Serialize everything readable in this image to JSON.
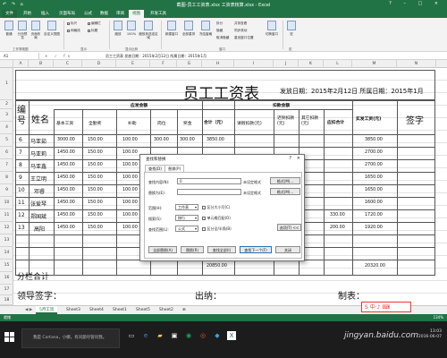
{
  "window": {
    "title": "截图-员工工资表.xlsx 工资表核算.xlsx - Excel",
    "quick_access": "↶ ↷ ⌂",
    "controls": "? – □ ×"
  },
  "ribbon_tabs": [
    "文件",
    "开始",
    "插入",
    "页面布局",
    "公式",
    "数据",
    "审阅",
    "视图",
    "开发工具"
  ],
  "ribbon": {
    "normal": "普通",
    "page_break": "分页预览",
    "page_layout": "页面布局",
    "custom_views": "自定义视图",
    "ruler": "标尺",
    "formula_bar": "编辑栏",
    "gridlines": "网格线",
    "headings": "标题",
    "zoom": "缩放",
    "zoom100": "100%",
    "zoom_sel": "缩放到选定区域",
    "new_window": "新建窗口",
    "arrange_all": "全部重排",
    "freeze": "冻结窗格",
    "split": "拆分",
    "hide": "隐藏",
    "unhide": "取消隐藏",
    "side_by_side": "并排查看",
    "sync_scroll": "同步滚动",
    "reset_pos": "重设窗口位置",
    "switch_window": "切换窗口",
    "macros": "宏",
    "g1": "工作簿视图",
    "g2": "显示",
    "g3": "显示比例",
    "g4": "窗口",
    "g5": "宏"
  },
  "formula_bar": {
    "name_box": "A1",
    "fx": "✕ ✓ fx",
    "value": "员工工资表    发放日期：2015年2月12日 所属日期：2015年1月"
  },
  "columns": [
    "A",
    "B",
    "C",
    "D",
    "E",
    "F",
    "G",
    "H",
    "I",
    "J",
    "K",
    "L",
    "M",
    "N"
  ],
  "rows": [
    "1",
    "2",
    "3",
    "4",
    "5",
    "6",
    "7",
    "8",
    "9",
    "10",
    "11",
    "12",
    "13",
    "14",
    "15",
    "16",
    "17",
    "18"
  ],
  "sheet": {
    "title": "员工工资表",
    "dates": "发放日期：2015年2月12日 所属日期：2015年1月",
    "h_no": "编号",
    "h_name": "姓名",
    "h_pay": "应发金额",
    "h_deduct": "扣款金额",
    "h_base": "基本工资",
    "h_full": "全勤奖",
    "h_subsidy": "补助",
    "h_post": "岗位",
    "h_bonus": "奖金",
    "h_total": "合计（元）",
    "h_leave": "请假扣款(元)",
    "h_late": "迟到扣款(元)",
    "h_other": "其它扣款(元)",
    "h_deduct_total": "应扣合计",
    "h_actual": "实发工资(元)",
    "h_sign": "签字",
    "employees": [
      {
        "no": "6",
        "name": "马亚茹",
        "base": "3000.00",
        "full": "150.00",
        "sub": "100.00",
        "post": "300.00",
        "bonus": "300.00",
        "total": "3850.00",
        "actual": "3850.00"
      },
      {
        "no": "7",
        "name": "马亚莉",
        "base": "1450.00",
        "full": "150.00",
        "sub": "100.00",
        "post": "",
        "bonus": "",
        "total": "",
        "actual": "2700.00"
      },
      {
        "no": "8",
        "name": "马亚鑫",
        "base": "1450.00",
        "full": "150.00",
        "sub": "100.00",
        "post": "",
        "bonus": "",
        "total": "",
        "actual": "2700.00"
      },
      {
        "no": "9",
        "name": "王立明",
        "base": "1450.00",
        "full": "150.00",
        "sub": "100.00",
        "post": "",
        "bonus": "",
        "total": "",
        "actual": "1650.00"
      },
      {
        "no": "10",
        "name": "邓睿",
        "base": "1450.00",
        "full": "150.00",
        "sub": "100.00",
        "post": "",
        "bonus": "",
        "total": "",
        "actual": "1650.00"
      },
      {
        "no": "11",
        "name": "张爱琴",
        "base": "1450.00",
        "full": "150.00",
        "sub": "100.00",
        "post": "",
        "bonus": "",
        "total": "",
        "actual": "1600.00"
      },
      {
        "no": "12",
        "name": "郑国斌",
        "base": "1450.00",
        "full": "150.00",
        "sub": "100.00",
        "post": "",
        "bonus": "",
        "total": "",
        "actual": "1720.00"
      },
      {
        "no": "13",
        "name": "高阳",
        "base": "1450.00",
        "full": "150.00",
        "sub": "100.00",
        "post": "",
        "bonus": "",
        "total": "",
        "actual": "1920.00"
      }
    ],
    "deduct_extra": [
      {
        "row": "12",
        "val": "330.00"
      },
      {
        "row": "13",
        "val": "200.00"
      }
    ],
    "total_label": "分栏合计",
    "total_sum": "20850.00",
    "total_actual": "20320.00",
    "footer_leader": "领导签字：",
    "footer_cashier": "出纳：",
    "footer_maker": "制表："
  },
  "dialog": {
    "title": "查找和替换",
    "help": "?",
    "close": "×",
    "tab_find": "查找(D)",
    "tab_replace": "替换(P)",
    "find_label": "查找内容(N):",
    "find_value": "0",
    "replace_label": "替换为(E):",
    "replace_value": "",
    "fmt_status1": "未设定格式",
    "fmt_status2": "未设定格式",
    "fmt_btn1": "格式(M)...",
    "fmt_btn2": "格式(M)...",
    "scope_label": "范围(H):",
    "scope_value": "工作表",
    "search_label": "搜索(S):",
    "search_value": "按行",
    "lookin_label": "查找范围(L):",
    "lookin_value": "公式",
    "opt_case": "区分大小写(C)",
    "opt_whole": "单元格匹配(O)",
    "opt_width": "区分全/半角(B)",
    "options_btn": "选项(T) <<",
    "btn_replace_all": "全部替换(A)",
    "btn_replace": "替换(R)",
    "btn_find_all": "查找全部(I)",
    "btn_find_next": "查找下一个(F)",
    "btn_close": "关闭"
  },
  "sheet_tabs": [
    "5月工资",
    "Sheet3",
    "Sheet4",
    "Sheet1",
    "Sheet5",
    "Sheet2",
    "⊕"
  ],
  "status": {
    "left": "就绪",
    "zoom": "134%"
  },
  "taskbar": {
    "search": "我是 Cortana，小娜。有问题尽管问我。",
    "time": "13:03",
    "date": "2016-06-07"
  },
  "watermark": "jingyan.baidu.com",
  "logo_text": "S 中·♪ ⌨"
}
